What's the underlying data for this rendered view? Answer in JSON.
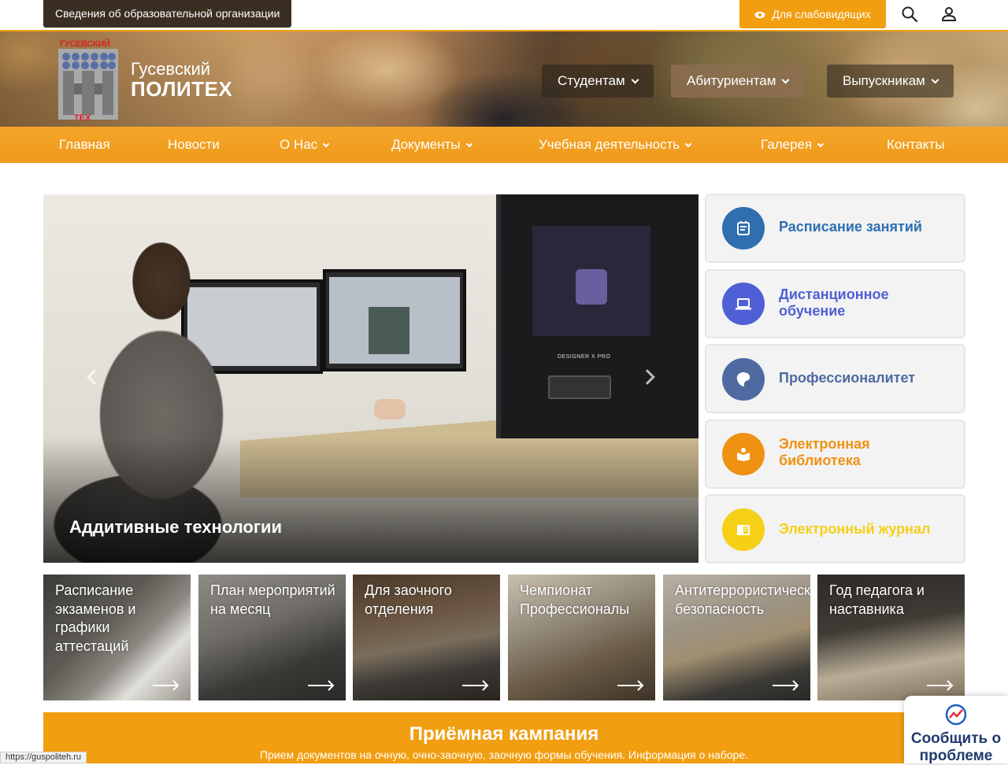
{
  "topbar": {
    "org_info_label": "Сведения об образовательной организации",
    "vision_label": "Для слабовидящих",
    "search_icon": "search-icon",
    "user_icon": "user-icon",
    "accent_color": "#f29e11"
  },
  "header": {
    "logo_text_top": "ГУСЕВСКИЙ",
    "logo_text_bottom": "ТЕХ",
    "site_name_line1": "Гусевский",
    "site_name_line2": "ПОЛИТЕХ",
    "audience_tabs": [
      {
        "label": "Студентам"
      },
      {
        "label": "Абитуриентам"
      },
      {
        "label": "Выпускникам"
      }
    ]
  },
  "mainnav": {
    "items": [
      {
        "label": "Главная"
      },
      {
        "label": "Новости"
      },
      {
        "label": "О Нас"
      },
      {
        "label": "Документы"
      },
      {
        "label": "Учебная деятельность"
      },
      {
        "label": "Галерея"
      },
      {
        "label": "Контакты"
      }
    ]
  },
  "slider": {
    "caption": "Аддитивные технологии",
    "printer_brand": "DESIGNER X PRO"
  },
  "quick_links": [
    {
      "label": "Расписание занятий",
      "color": "#2f6fb0",
      "icon": "schedule-icon"
    },
    {
      "label": "Дистанционное обучение",
      "color": "#4f5fd6",
      "icon": "laptop-icon"
    },
    {
      "label": "Профессионалитет",
      "color": "#4e6aa0",
      "icon": "professionalitet-icon"
    },
    {
      "label": "Электронная библиотека",
      "color": "#ef9212",
      "icon": "library-icon"
    },
    {
      "label": "Электронный журнал",
      "color": "#f5d017",
      "icon": "journal-icon"
    }
  ],
  "tiles": [
    {
      "title": "Расписание экзаменов и графики аттестаций"
    },
    {
      "title": "План мероприятий на месяц"
    },
    {
      "title": "Для заочного отделения"
    },
    {
      "title": "Чемпионат Профессионалы"
    },
    {
      "title": "Антитеррористическая безопасность"
    },
    {
      "title": "Год педагога и наставника"
    }
  ],
  "admission": {
    "title": "Приёмная кампания",
    "subtitle": "Прием документов на очную, очно-заочную, заочную формы обучения. Информация о наборе."
  },
  "report_widget": {
    "label": "Сообщить о проблеме"
  },
  "status_url": "https://guspoliteh.ru"
}
